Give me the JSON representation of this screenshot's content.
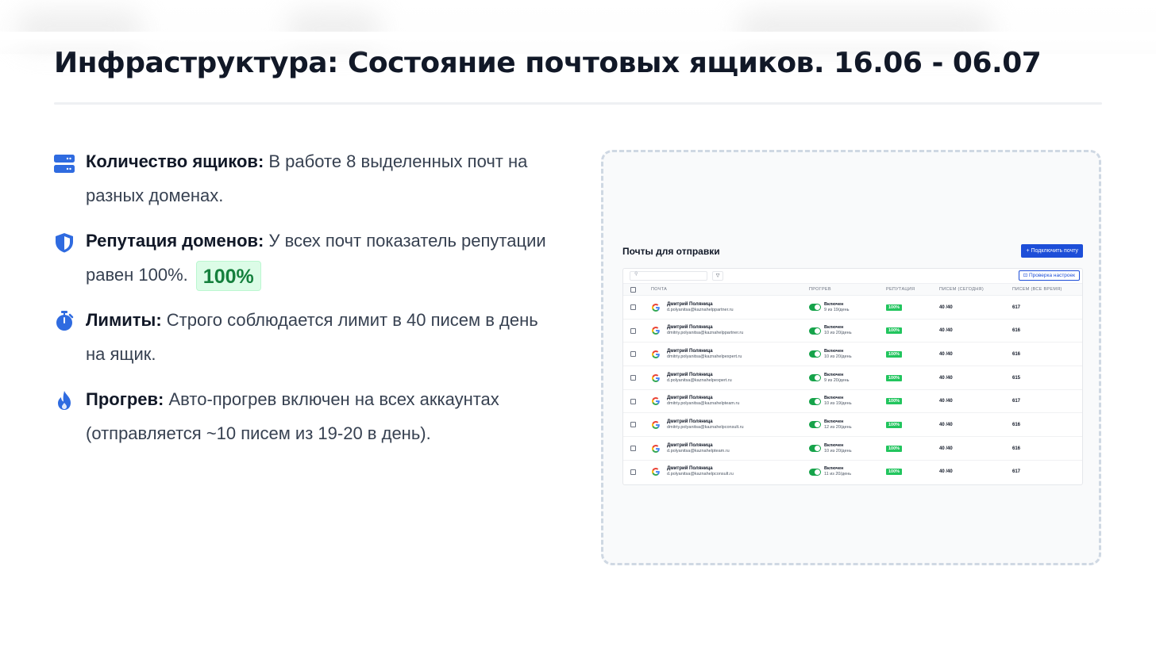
{
  "title": "Инфраструктура: Состояние почтовых ящиков. 16.06 - 06.07",
  "colors": {
    "accent_blue": "#2f6be0",
    "reputation_green": "#22c55e",
    "badge_green_text": "#15803d",
    "badge_green_bg": "#dcfce7"
  },
  "bullets": [
    {
      "icon": "server-icon",
      "label": "Количество ящиков:",
      "text": " В работе 8 выделенных почт на разных доменах."
    },
    {
      "icon": "shield-icon",
      "label": "Репутация доменов:",
      "text": " У всех почт показатель репутации равен 100%.",
      "badge": "100%"
    },
    {
      "icon": "stopwatch-icon",
      "label": "Лимиты:",
      "text": " Строго соблюдается лимит в 40 писем в день на ящик."
    },
    {
      "icon": "flame-icon",
      "label": "Прогрев:",
      "text": " Авто-прогрев включен на всех аккаунтах (отправляется ~10 писем из 19-20 в день)."
    }
  ],
  "screenshot": {
    "heading": "Почты для отправки",
    "connect_button": "+ Подключить почту",
    "check_button": "Проверка настроек",
    "search_icon": "search-icon",
    "filter_icon": "filter-icon",
    "columns": [
      "ПОЧТА",
      "ПРОГРЕВ",
      "РЕПУТАЦИЯ",
      "ПИСЕМ (СЕГОДНЯ)",
      "ПИСЕМ (ВСЕ ВРЕМЯ)"
    ],
    "rows": [
      {
        "name": "Дмитрий Поляница",
        "email": "d.polyanitsa@kaznahelppartner.ru",
        "warm_state": "Включен",
        "warm_count": "9 из 19/день",
        "reputation": "100%",
        "today": "40 /40",
        "total": "617"
      },
      {
        "name": "Дмитрий Поляница",
        "email": "dmitriy.polyanitsa@kaznahelppartner.ru",
        "warm_state": "Включен",
        "warm_count": "10 из 20/день",
        "reputation": "100%",
        "today": "40 /40",
        "total": "616"
      },
      {
        "name": "Дмитрий Поляница",
        "email": "dmitriy.polyanitsa@kaznahelpexpert.ru",
        "warm_state": "Включен",
        "warm_count": "10 из 20/день",
        "reputation": "100%",
        "today": "40 /40",
        "total": "616"
      },
      {
        "name": "Дмитрий Поляница",
        "email": "d.polyanitsa@kaznahelpexpert.ru",
        "warm_state": "Включен",
        "warm_count": "9 из 20/день",
        "reputation": "100%",
        "today": "40 /40",
        "total": "615"
      },
      {
        "name": "Дмитрий Поляница",
        "email": "dmitriy.polyanitsa@kaznahelpteam.ru",
        "warm_state": "Включен",
        "warm_count": "10 из 19/день",
        "reputation": "100%",
        "today": "40 /40",
        "total": "617"
      },
      {
        "name": "Дмитрий Поляница",
        "email": "dmitriy.polyanitsa@kaznahelpconsult.ru",
        "warm_state": "Включен",
        "warm_count": "12 из 20/день",
        "reputation": "100%",
        "today": "40 /40",
        "total": "616"
      },
      {
        "name": "Дмитрий Поляница",
        "email": "d.polyanitsa@kaznahelpteam.ru",
        "warm_state": "Включен",
        "warm_count": "10 из 20/день",
        "reputation": "100%",
        "today": "40 /40",
        "total": "616"
      },
      {
        "name": "Дмитрий Поляница",
        "email": "d.polyanitsa@kaznahelpconsult.ru",
        "warm_state": "Включен",
        "warm_count": "11 из 20/день",
        "reputation": "100%",
        "today": "40 /40",
        "total": "617"
      }
    ]
  }
}
